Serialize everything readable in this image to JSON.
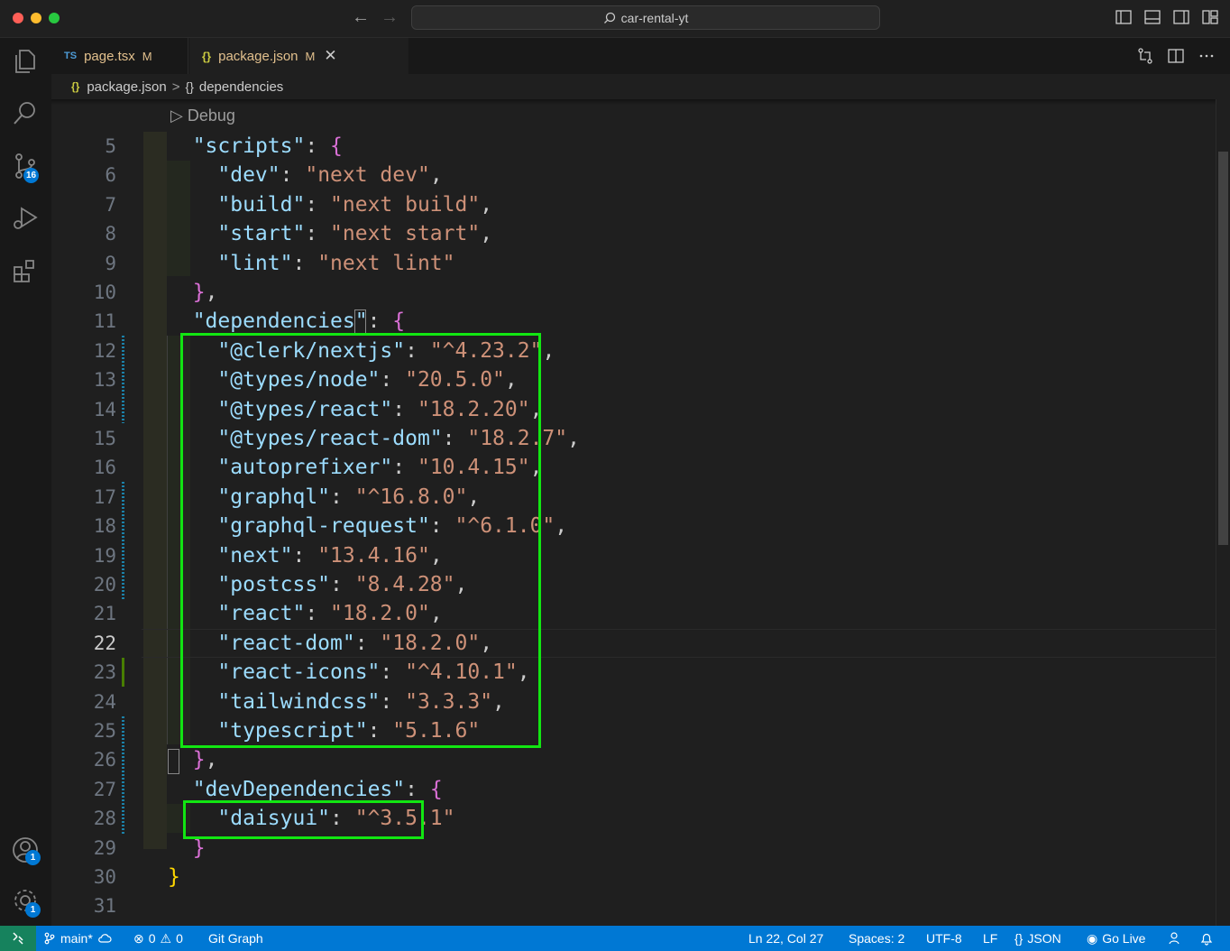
{
  "window": {
    "search_text": "car-rental-yt"
  },
  "activity": {
    "source_control_badge": "16",
    "accounts_badge": "1",
    "settings_badge": "1"
  },
  "tabs": [
    {
      "icon": "TS",
      "label": "page.tsx",
      "status": "M"
    },
    {
      "icon": "{}",
      "label": "package.json",
      "status": "M",
      "close": "✕"
    }
  ],
  "breadcrumb": {
    "icon": "{}",
    "file": "package.json",
    "sep": ">",
    "icon2": "{}",
    "symbol": "dependencies"
  },
  "editor": {
    "codelens": "Debug",
    "active_line": 22,
    "lines": [
      {
        "n": "5"
      },
      {
        "n": "6"
      },
      {
        "n": "7"
      },
      {
        "n": "8"
      },
      {
        "n": "9"
      },
      {
        "n": "10"
      },
      {
        "n": "11"
      },
      {
        "n": "12"
      },
      {
        "n": "13"
      },
      {
        "n": "14"
      },
      {
        "n": "15"
      },
      {
        "n": "16"
      },
      {
        "n": "17"
      },
      {
        "n": "18"
      },
      {
        "n": "19"
      },
      {
        "n": "20"
      },
      {
        "n": "21"
      },
      {
        "n": "22"
      },
      {
        "n": "23"
      },
      {
        "n": "24"
      },
      {
        "n": "25"
      },
      {
        "n": "26"
      },
      {
        "n": "27"
      },
      {
        "n": "28"
      },
      {
        "n": "29"
      },
      {
        "n": "30"
      },
      {
        "n": "31"
      }
    ],
    "scripts": [
      {
        "key": "\"dev\"",
        "value": "\"next dev\"",
        "comma": ","
      },
      {
        "key": "\"build\"",
        "value": "\"next build\"",
        "comma": ","
      },
      {
        "key": "\"start\"",
        "value": "\"next start\"",
        "comma": ","
      },
      {
        "key": "\"lint\"",
        "value": "\"next lint\"",
        "comma": ""
      }
    ],
    "dependencies": [
      {
        "key": "\"@clerk/nextjs\"",
        "value": "\"^4.23.2\"",
        "comma": ","
      },
      {
        "key": "\"@types/node\"",
        "value": "\"20.5.0\"",
        "comma": ","
      },
      {
        "key": "\"@types/react\"",
        "value": "\"18.2.20\"",
        "comma": ","
      },
      {
        "key": "\"@types/react-dom\"",
        "value": "\"18.2.7\"",
        "comma": ","
      },
      {
        "key": "\"autoprefixer\"",
        "value": "\"10.4.15\"",
        "comma": ","
      },
      {
        "key": "\"graphql\"",
        "value": "\"^16.8.0\"",
        "comma": ","
      },
      {
        "key": "\"graphql-request\"",
        "value": "\"^6.1.0\"",
        "comma": ","
      },
      {
        "key": "\"next\"",
        "value": "\"13.4.16\"",
        "comma": ","
      },
      {
        "key": "\"postcss\"",
        "value": "\"8.4.28\"",
        "comma": ","
      },
      {
        "key": "\"react\"",
        "value": "\"18.2.0\"",
        "comma": ","
      },
      {
        "key": "\"react-dom\"",
        "value": "\"18.2.0\"",
        "comma": ","
      },
      {
        "key": "\"react-icons\"",
        "value": "\"^4.10.1\"",
        "comma": ","
      },
      {
        "key": "\"tailwindcss\"",
        "value": "\"3.3.3\"",
        "comma": ","
      },
      {
        "key": "\"typescript\"",
        "value": "\"5.1.6\"",
        "comma": ""
      }
    ],
    "dev_dependencies": [
      {
        "key": "\"daisyui\"",
        "value": "\"^3.5.1\"",
        "comma": ""
      }
    ],
    "keys": {
      "scripts": "\"scripts\"",
      "dependencies": "\"dependencies\"",
      "devDependencies": "\"devDependencies\""
    }
  },
  "statusbar": {
    "branch": "main*",
    "errors": "0",
    "warnings": "0",
    "git_graph": "Git Graph",
    "position": "Ln 22, Col 27",
    "spaces": "Spaces: 2",
    "encoding": "UTF-8",
    "eol": "LF",
    "language": "JSON",
    "golive": "Go Live"
  }
}
